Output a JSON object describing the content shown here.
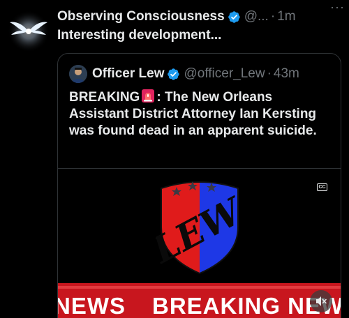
{
  "post": {
    "display_name": "Observing Consciousness",
    "handle": "@...",
    "separator": "·",
    "time": "1m",
    "more": "···",
    "text": "Interesting development..."
  },
  "quote": {
    "display_name": "Officer Lew",
    "handle": "@officer_Lew",
    "separator": "·",
    "time": "43m",
    "text_before_emoji": "BREAKING",
    "text_after_emoji": ": The New Orleans Assistant District Attorney Ian Kersting was found dead in an apparent suicide."
  },
  "media": {
    "logo_text": "LEW",
    "cc_label": "CC",
    "ticker_words": [
      "NEWS",
      "BREAKING NEWS"
    ],
    "icons": [
      "star-icon",
      "cc-icon",
      "mute-icon"
    ]
  },
  "colors": {
    "background": "#000000",
    "text_primary": "#e7e9ea",
    "text_secondary": "#71767b",
    "verified": "#1d9bf0",
    "news_red": "#c8161e",
    "shield_red": "#e01b1b",
    "shield_blue": "#1e38e6"
  }
}
